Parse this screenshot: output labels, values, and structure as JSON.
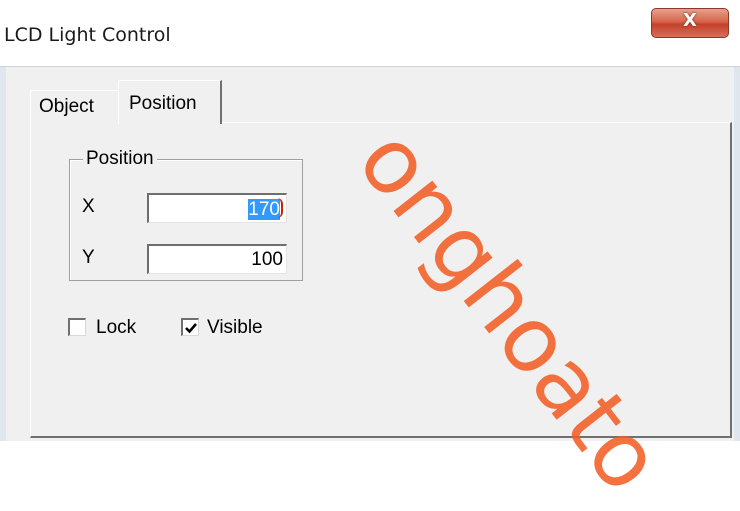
{
  "window": {
    "title": "LCD Light Control",
    "close_glyph": "X"
  },
  "tabs": [
    {
      "label": "Object",
      "active": false
    },
    {
      "label": "Position",
      "active": true
    }
  ],
  "position_group": {
    "legend": "Position",
    "x_label": "X",
    "x_value": "170",
    "y_label": "Y",
    "y_value": "100"
  },
  "checkboxes": {
    "lock": {
      "label": "Lock",
      "checked": false
    },
    "visible": {
      "label": "Visible",
      "checked": true
    }
  },
  "watermark": {
    "text": "onghoato"
  },
  "colors": {
    "selection": "#3399ff",
    "close_button": "#c4412a",
    "watermark": "#f25a1f"
  }
}
